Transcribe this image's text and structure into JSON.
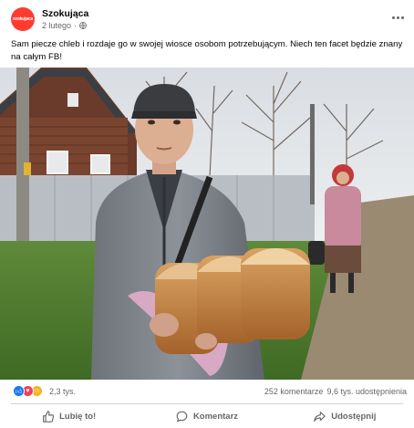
{
  "post": {
    "page_name": "Szokująca",
    "avatar_text": "szokujaca",
    "date": "2 lutego",
    "separator": "·",
    "caption": "Sam piecze chleb i rozdaje go w swojej wiosce osobom potrzebującym. Niech ten facet będzie znany na całym FB!"
  },
  "reactions": {
    "count": "2,3 tys.",
    "icons": [
      "like-icon",
      "love-icon",
      "care-icon"
    ],
    "comments": "252 komentarze",
    "shares": "9,6 tys. udostępnienia"
  },
  "actions": {
    "like": "Lubię to!",
    "comment": "Komentarz",
    "share": "Udostępnij"
  },
  "colors": {
    "avatar": "#ff3b30",
    "like": "#1877f2",
    "love": "#f33e58",
    "care": "#f7b125"
  }
}
